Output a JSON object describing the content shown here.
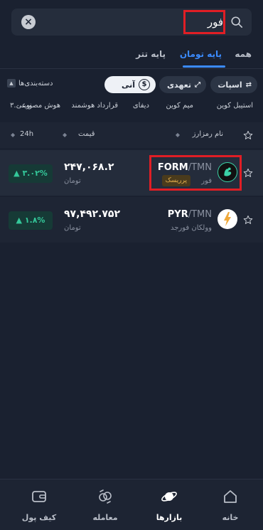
{
  "search": {
    "value": "فور",
    "placeholder": "",
    "clear_glyph": "×",
    "icon": "search-icon"
  },
  "tabs": [
    {
      "label": "همه",
      "active": false
    },
    {
      "label": "پایه تومان",
      "active": true
    },
    {
      "label": "پایه تتر",
      "active": false
    }
  ],
  "filters": {
    "spot": "اسپات",
    "futures": "تعهدی",
    "instant": "آنی",
    "instant_glyph": "$",
    "categories": "دسته‌بندی‌ها"
  },
  "subcategories": [
    "استیبل کوین",
    "میم کوین",
    "دیفای",
    "قرارداد هوشمند",
    "هوش مصنوعی",
    "وب ۳.۰"
  ],
  "table": {
    "col_name": "نام رمزارز",
    "col_price": "قیمت",
    "col_change": "24h"
  },
  "rows": [
    {
      "base": "FORM",
      "quote": "/TMN",
      "name": "فور",
      "badge": "پرریسک",
      "price": "۲۴۷,۰۶۸.۲",
      "unit": "تومان",
      "change": "▲ ۳.۰۲%",
      "logo": "form-logo-icon"
    },
    {
      "base": "PYR",
      "quote": "/TMN",
      "name": "وولکان فورجد",
      "price": "۹۷,۴۹۲.۷۵۲",
      "unit": "تومان",
      "change": "▲ ۱.۸%",
      "logo": "pyr-logo-icon"
    }
  ],
  "nav": {
    "home": "خانه",
    "markets": "بازارها",
    "trade": "معامله",
    "wallet": "کیف پول"
  },
  "colors": {
    "background": "#1a2130",
    "accent": "#3b8bff",
    "positive": "#34c89a",
    "highlight": "#e01e25"
  }
}
